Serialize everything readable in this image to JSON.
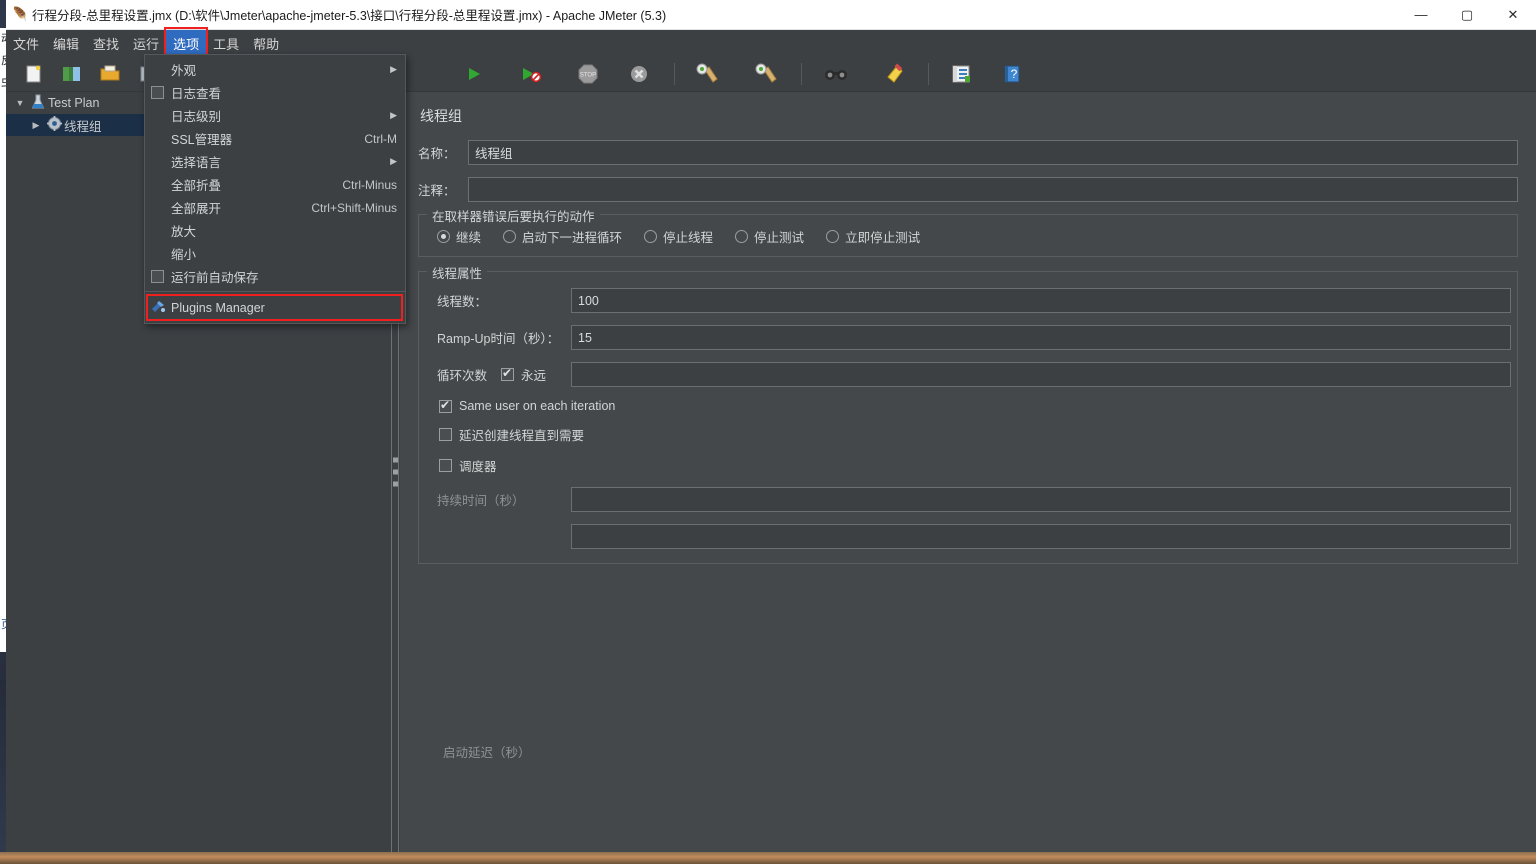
{
  "window": {
    "title": "行程分段-总里程设置.jmx (D:\\软件\\Jmeter\\apache-jmeter-5.3\\接口\\行程分段-总里程设置.jmx) - Apache JMeter (5.3)",
    "app_icon": "jmeter-feather-icon",
    "controls": {
      "minimize": "—",
      "maximize": "▢",
      "close": "✕"
    }
  },
  "menubar": {
    "items": [
      {
        "label": "文件",
        "active": false
      },
      {
        "label": "编辑",
        "active": false
      },
      {
        "label": "查找",
        "active": false
      },
      {
        "label": "运行",
        "active": false
      },
      {
        "label": "选项",
        "active": true,
        "annotated": true
      },
      {
        "label": "工具",
        "active": false
      },
      {
        "label": "帮助",
        "active": false
      }
    ]
  },
  "toolbar": {
    "buttons": [
      {
        "name": "new-icon",
        "glyph": "▢",
        "sep_after": false
      },
      {
        "name": "templates-icon",
        "glyph": "▣",
        "sep_after": false
      },
      {
        "name": "open-icon",
        "glyph": "▤",
        "sep_after": false
      },
      {
        "name": "save-icon",
        "glyph": "▥",
        "sep_after": true
      }
    ],
    "right_buttons": [
      {
        "name": "start-icon",
        "glyph": "▶"
      },
      {
        "name": "start-no-pauses-icon",
        "glyph": "▶"
      },
      {
        "name": "stop-icon",
        "glyph": "⏹"
      },
      {
        "name": "shutdown-icon",
        "glyph": "✖"
      },
      {
        "name": "clear-icon",
        "glyph": "🧹"
      },
      {
        "name": "clear-all-icon",
        "glyph": "🧹"
      },
      {
        "name": "search-icon",
        "glyph": "🔍"
      },
      {
        "name": "reset-search-icon",
        "glyph": "🧹"
      },
      {
        "name": "function-helper-icon",
        "glyph": "▤"
      },
      {
        "name": "help-icon",
        "glyph": "?"
      }
    ]
  },
  "dropdown": {
    "items": [
      {
        "id": "look-and-feel",
        "label": "外观",
        "checkbox": null,
        "accel": "",
        "submenu": true
      },
      {
        "id": "log-viewer",
        "label": "日志查看",
        "checkbox": false,
        "accel": "",
        "submenu": false
      },
      {
        "id": "log-level",
        "label": "日志级别",
        "checkbox": null,
        "accel": "",
        "submenu": true
      },
      {
        "id": "ssl-manager",
        "label": "SSL管理器",
        "checkbox": null,
        "accel": "Ctrl-M",
        "submenu": false
      },
      {
        "id": "choose-language",
        "label": "选择语言",
        "checkbox": null,
        "accel": "",
        "submenu": true
      },
      {
        "id": "collapse-all",
        "label": "全部折叠",
        "checkbox": null,
        "accel": "Ctrl-Minus",
        "submenu": false
      },
      {
        "id": "expand-all",
        "label": "全部展开",
        "checkbox": null,
        "accel": "Ctrl+Shift-Minus",
        "submenu": false
      },
      {
        "id": "zoom-in",
        "label": "放大",
        "checkbox": null,
        "accel": "",
        "submenu": false
      },
      {
        "id": "zoom-out",
        "label": "缩小",
        "checkbox": null,
        "accel": "",
        "submenu": false
      },
      {
        "id": "auto-save-before-run",
        "label": "运行前自动保存",
        "checkbox": false,
        "accel": "",
        "submenu": false
      }
    ],
    "plugins_manager": {
      "label": "Plugins Manager",
      "icon": "plugins-manager-icon",
      "annotated": true
    }
  },
  "tree": {
    "nodes": [
      {
        "id": "test-plan",
        "label": "Test Plan",
        "icon": "test-plan-icon",
        "toggle": "▼",
        "indent": 0,
        "selected": false
      },
      {
        "id": "thread-group",
        "label": "线程组",
        "icon": "thread-group-icon",
        "toggle": "▶",
        "indent": 1,
        "selected": true
      }
    ]
  },
  "main": {
    "panel_title": "线程组",
    "name_label": "名称：",
    "name_value": "线程组",
    "comment_label": "注释：",
    "comment_value": "",
    "error_action": {
      "group_title": "在取样器错误后要执行的动作",
      "options": [
        {
          "label": "继续",
          "checked": true
        },
        {
          "label": "启动下一进程循环",
          "checked": false
        },
        {
          "label": "停止线程",
          "checked": false
        },
        {
          "label": "停止测试",
          "checked": false
        },
        {
          "label": "立即停止测试",
          "checked": false
        }
      ]
    },
    "thread_properties": {
      "group_title": "线程属性",
      "threads_label": "线程数：",
      "threads_value": "100",
      "rampup_label": "Ramp-Up时间（秒）：",
      "rampup_value": "15",
      "loops_label": "循环次数",
      "forever_label": "永远",
      "forever_checked": true,
      "loops_value": "",
      "same_user_label": "Same user on each iteration",
      "same_user_checked": true,
      "delayed_start_label": "延迟创建线程直到需要",
      "delayed_start_checked": false,
      "scheduler_label": "调度器",
      "scheduler_checked": false,
      "duration_label": "持续时间（秒）",
      "duration_value": "",
      "startup_delay_label": "启动延迟（秒）",
      "startup_delay_value": ""
    }
  },
  "background": {
    "left_fragments": [
      "动",
      "反",
      "虫"
    ],
    "left_bottom_fragment": "页"
  },
  "colors": {
    "window_bg": "#3c4043",
    "panel_bg": "#44484a",
    "text": "#d2d5d6",
    "accent_menu": "#2f6bbf",
    "annotation_red": "#ee2020",
    "tree_selection": "#1b2f47"
  }
}
